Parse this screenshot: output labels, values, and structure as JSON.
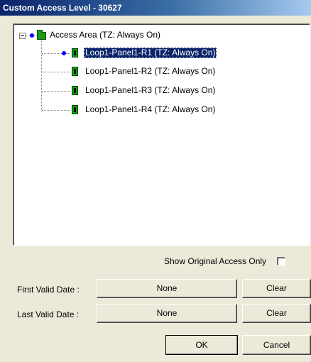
{
  "window": {
    "title": "Custom Access Level - 30627"
  },
  "tree": {
    "root": {
      "label": "Access Area (TZ: Always On)",
      "dot_color": "#0000ff"
    },
    "children": [
      {
        "label": "Loop1-Panel1-R1 (TZ: Always On)",
        "selected": true,
        "dot_color": "#0000ff"
      },
      {
        "label": "Loop1-Panel1-R2 (TZ: Always On)",
        "selected": false
      },
      {
        "label": "Loop1-Panel1-R3 (TZ: Always On)",
        "selected": false
      },
      {
        "label": "Loop1-Panel1-R4 (TZ: Always On)",
        "selected": false
      }
    ]
  },
  "options": {
    "show_original_label": "Show Original Access Only",
    "show_original_checked": false
  },
  "first_valid": {
    "label": "First Valid Date :",
    "value": "None",
    "clear_label": "Clear"
  },
  "last_valid": {
    "label": "Last Valid Date :",
    "value": "None",
    "clear_label": "Clear"
  },
  "footer": {
    "ok_label": "OK",
    "cancel_label": "Cancel"
  },
  "colors": {
    "reader_green": "#12a012",
    "selection": "#0a246a",
    "dialog_bg": "#ece9d8"
  }
}
